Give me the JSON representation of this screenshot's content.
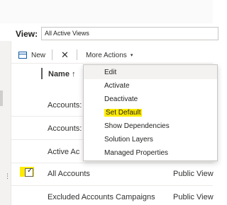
{
  "view": {
    "label": "View:",
    "selected": "All Active Views"
  },
  "commands": {
    "new_label": "New",
    "delete_glyph": "✕",
    "more_actions_label": "More Actions",
    "caret": "▾"
  },
  "grid": {
    "name_header": "Name ↑",
    "rows": [
      {
        "name": "Accounts:",
        "type": ""
      },
      {
        "name": "Accounts:",
        "type": ""
      },
      {
        "name": "Active Ac",
        "type": ""
      },
      {
        "name": "All Accounts",
        "type": "Public View",
        "selected": true
      },
      {
        "name": "Excluded Accounts Campaigns",
        "type": "Public View"
      }
    ]
  },
  "menu": {
    "items": [
      "Edit",
      "Activate",
      "Deactivate",
      "Set Default",
      "Show Dependencies",
      "Solution Layers",
      "Managed Properties"
    ],
    "highlighted": "Set Default"
  },
  "colors": {
    "highlight": "#ffeb00",
    "accent": "#0f5aa8"
  },
  "left_rail": {
    "dots": "⋮"
  }
}
